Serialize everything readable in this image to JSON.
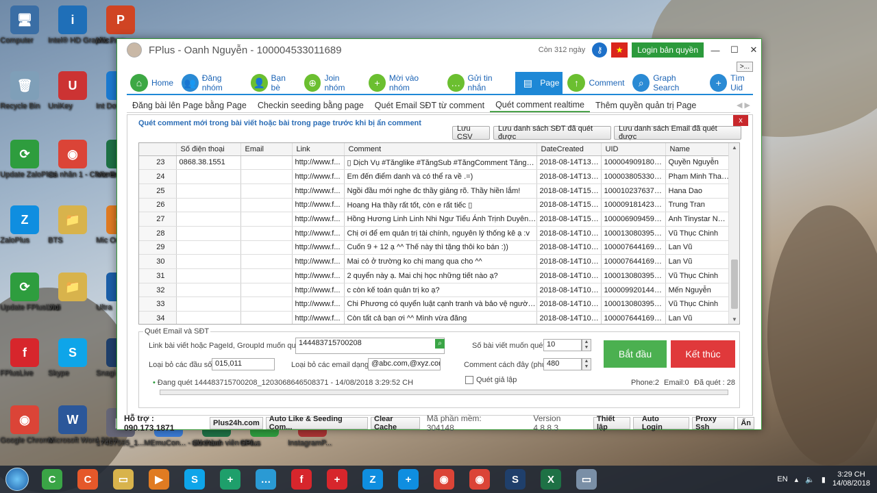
{
  "desktop": {
    "icons": [
      {
        "label": "Computer",
        "glyph": "🖥",
        "color": "#3a6ea5"
      },
      {
        "label": "Intel® HD Graphic...",
        "glyph": "i",
        "color": "#1f6fb8"
      },
      {
        "label": "Mic Pow",
        "glyph": "P",
        "color": "#d04423"
      },
      {
        "label": "Recycle Bin",
        "glyph": "🗑",
        "color": "#7f9fb8"
      },
      {
        "label": "UniKey",
        "glyph": "U",
        "color": "#c33"
      },
      {
        "label": "Int Dov",
        "glyph": "e",
        "color": "#1b7ad1"
      },
      {
        "label": "Update ZaloPlus",
        "glyph": "⟳",
        "color": "#2e9d3e"
      },
      {
        "label": "Cá nhân 1 - Chrome",
        "glyph": "◉",
        "color": "#db4437"
      },
      {
        "label": "Mic Exc",
        "glyph": "X",
        "color": "#1e7145"
      },
      {
        "label": "ZaloPlus",
        "glyph": "Z",
        "color": "#0f8ee0"
      },
      {
        "label": "BTS",
        "glyph": "📁",
        "color": "#d8b34c"
      },
      {
        "label": "Mic Outlo",
        "glyph": "O",
        "color": "#e07b22"
      },
      {
        "label": "Update FPlusLive",
        "glyph": "⟳",
        "color": "#2e9d3e"
      },
      {
        "label": "Vidi",
        "glyph": "📁",
        "color": "#d8b34c"
      },
      {
        "label": "Ultra",
        "glyph": "U",
        "color": "#1c5fa8"
      },
      {
        "label": "FPlusLive",
        "glyph": "f",
        "color": "#d7262c"
      },
      {
        "label": "Skype",
        "glyph": "S",
        "color": "#0ea5e9"
      },
      {
        "label": "Snagi - Sh",
        "glyph": "S",
        "color": "#1f3f6b"
      },
      {
        "label": "Google Chrome",
        "glyph": "◉",
        "color": "#db4437"
      },
      {
        "label": "Microsoft Word 2010",
        "glyph": "W",
        "color": "#2b579a"
      },
      {
        "label": "17457595_1...",
        "glyph": "▦",
        "color": "#667"
      },
      {
        "label": "MEmuCon... - Shortcut",
        "glyph": "M",
        "color": "#3a7bd5"
      },
      {
        "label": "uid thành viên nhó...",
        "glyph": "X",
        "color": "#1e7145"
      },
      {
        "label": "GPlus",
        "glyph": "G",
        "color": "#2e9d3e"
      },
      {
        "label": "InstagramP...",
        "glyph": "I",
        "color": "#a33"
      }
    ]
  },
  "window": {
    "title": "FPlus - Oanh Nguyễn - 100004533011689",
    "remaining": "Còn 312 ngày",
    "login_label": "Login bản quyền",
    "more_label": ">..."
  },
  "nav": [
    {
      "label": "Home",
      "icon": "home-icon",
      "glyph": "⌂",
      "color": "#3da844"
    },
    {
      "label": "Đăng nhóm",
      "icon": "group-post-icon",
      "glyph": "👥",
      "color": "#2a8ad4"
    },
    {
      "label": "Bạn bè",
      "icon": "friends-icon",
      "glyph": "👤",
      "color": "#6bbf30"
    },
    {
      "label": "Join nhóm",
      "icon": "join-group-icon",
      "glyph": "⊕",
      "color": "#6bbf30"
    },
    {
      "label": "Mời vào nhóm",
      "icon": "invite-icon",
      "glyph": "+",
      "color": "#6bbf30"
    },
    {
      "label": "Gửi tin nhắn",
      "icon": "message-icon",
      "glyph": "…",
      "color": "#6bbf30"
    },
    {
      "label": "Page",
      "icon": "page-icon",
      "glyph": "▤",
      "color": "#6bbf30"
    },
    {
      "label": "Comment",
      "icon": "comment-icon",
      "glyph": "↑",
      "color": "#6bbf30"
    },
    {
      "label": "Graph Search",
      "icon": "search-icon",
      "glyph": "⌕",
      "color": "#2a8ad4"
    },
    {
      "label": "Tìm Uid",
      "icon": "find-uid-icon",
      "glyph": "+",
      "color": "#2a8ad4"
    }
  ],
  "nav_active": "Page",
  "subtabs": [
    "Đăng bài lên Page bằng Page",
    "Checkin seeding bằng page",
    "Quét Email SĐT từ comment",
    "Quét comment realtime",
    "Thêm quyền quản trị Page"
  ],
  "panel": {
    "title": "Quét comment mới trong bài viết hoặc bài trong page trước khi bị ẩn comment",
    "buttons": [
      "Lưu CSV",
      "Lưu danh sách SĐT đã quét được",
      "Lưu danh sách Email đã quét được"
    ],
    "close_label": "x"
  },
  "grid": {
    "columns": [
      "",
      "Số điện thoại",
      "Email",
      "Link",
      "Comment",
      "DateCreated",
      "UID",
      "Name"
    ],
    "rows": [
      [
        "23",
        "0868.38.1551",
        "",
        "http://www.f...",
        "▯ Dịch Vụ #Tănglike #TăngSub #TăngComment  Tăng mắt ...",
        "2018-08-14T13:1...",
        "100004909180970",
        "Quyền Nguyễn"
      ],
      [
        "24",
        "",
        "",
        "http://www.f...",
        "Em đến điểm danh và có thể ra về .=)",
        "2018-08-14T13:1...",
        "100003805330344",
        "Phạm Minh Thanh"
      ],
      [
        "25",
        "",
        "",
        "http://www.f...",
        "Ngồi đầu mới nghe đc thầy giảng rõ. Thầy hiền lắm!",
        "2018-08-14T15:0...",
        "100010237637440",
        "Hana Dao"
      ],
      [
        "26",
        "",
        "",
        "http://www.f...",
        "Hoang Ha thầy rất tốt, còn e rất tiếc ▯",
        "2018-08-14T15:0...",
        "100009181423400",
        "Trung Tran"
      ],
      [
        "27",
        "",
        "",
        "http://www.f...",
        "Hồng Hương Linh Linh Nhi Ngư Tiểu Ánh Trịnh Duyên các ...",
        "2018-08-14T15:1...",
        "100006909459660",
        "Anh Tinystar Ngo..."
      ],
      [
        "28",
        "",
        "",
        "http://www.f...",
        "Chị ơi để em quản trị tài chính, nguyên lý thống kê ạ :v",
        "2018-08-14T10:2...",
        "100013080395075",
        "Vũ Thục Chinh"
      ],
      [
        "29",
        "",
        "",
        "http://www.f...",
        "Cuốn 9 + 12 ạ ^^ Thế này thì tặng thôi ko bán :))",
        "2018-08-14T10:2...",
        "100007644169144",
        "Lan Vũ"
      ],
      [
        "30",
        "",
        "",
        "http://www.f...",
        "Mai có ở trường ko chị mang qua cho ^^",
        "2018-08-14T10:2...",
        "100007644169144",
        "Lan Vũ"
      ],
      [
        "31",
        "",
        "",
        "http://www.f...",
        "2 quyển này ạ. Mai chị học những tiết nào ạ?",
        "2018-08-14T10:3...",
        "100013080395075",
        "Vũ Thục Chinh"
      ],
      [
        "32",
        "",
        "",
        "http://www.f...",
        "c còn kế toán quản trị ko ạ?",
        "2018-08-14T10:3...",
        "100009920144717",
        "Mến Nguyễn"
      ],
      [
        "33",
        "",
        "",
        "http://www.f...",
        "Chi Phương có quyển luật cạnh tranh và bảo vệ người tiêu ...",
        "2018-08-14T10:3...",
        "100013080395075",
        "Vũ Thục Chinh"
      ],
      [
        "34",
        "",
        "",
        "http://www.f...",
        "Còn tất cả bạn ơi ^^ Mình vừa đăng",
        "2018-08-14T10:3...",
        "100007644169144",
        "Lan Vũ"
      ]
    ]
  },
  "scan": {
    "group_title": "Quét Email và SĐT",
    "link_label": "Link bài viết hoặc PageId, GroupId muốn quét",
    "link_value": "144483715700208",
    "prefix_label": "Loại bỏ các đầu số",
    "prefix_value": "015,011",
    "email_label": "Loại bỏ các email dạng",
    "email_value": "@abc.com,@xyz.com",
    "posts_label": "Số bài viết muốn quét",
    "posts_value": "10",
    "interval_label": "Comment cách đây (phút)",
    "interval_value": "480",
    "fake_label": "Quét giả lập",
    "start_label": "Bắt đầu",
    "stop_label": "Kết thúc",
    "status": "Đang quét 144483715700208_1203068646508371 - 14/08/2018 3:29:52 CH",
    "phone_count": "Phone:2",
    "email_count": "Email:0",
    "scanned_count": "Đã quét : 28"
  },
  "statusbar": {
    "support": "Hỗ trợ : 090.173.1871",
    "btns_left": [
      "Plus24h.com",
      "Auto Like & Seeding Com...",
      "Clear Cache"
    ],
    "software_code": "Mã phần mềm: 304148",
    "version": "Version 4.8.8.3",
    "btns_right": [
      "Thiết lập",
      "Auto Login",
      "Proxy Ssh",
      "Ẩn"
    ]
  },
  "taskbar": {
    "items": [
      {
        "name": "ccleaner",
        "glyph": "C",
        "color": "#3aa546"
      },
      {
        "name": "ccleaner-2",
        "glyph": "C",
        "color": "#e5582a"
      },
      {
        "name": "explorer",
        "glyph": "▭",
        "color": "#d8b34c"
      },
      {
        "name": "media",
        "glyph": "▶",
        "color": "#e07b22"
      },
      {
        "name": "skype",
        "glyph": "S",
        "color": "#0ea5e9"
      },
      {
        "name": "plus-green",
        "glyph": "+",
        "color": "#1e9f6b"
      },
      {
        "name": "chat",
        "glyph": "…",
        "color": "#2a9ad4"
      },
      {
        "name": "fplus",
        "glyph": "f",
        "color": "#d7262c"
      },
      {
        "name": "plus-red",
        "glyph": "+",
        "color": "#d7262c"
      },
      {
        "name": "zalo",
        "glyph": "Z",
        "color": "#0f8ee0"
      },
      {
        "name": "plus-blue",
        "glyph": "+",
        "color": "#0f8ee0"
      },
      {
        "name": "chrome",
        "glyph": "◉",
        "color": "#db4437"
      },
      {
        "name": "chrome-2",
        "glyph": "◉",
        "color": "#db4437"
      },
      {
        "name": "snagit",
        "glyph": "S",
        "color": "#1f3f6b"
      },
      {
        "name": "excel",
        "glyph": "X",
        "color": "#1e7145"
      },
      {
        "name": "other",
        "glyph": "▭",
        "color": "#7a8fa6"
      }
    ],
    "lang": "EN",
    "time": "3:29 CH",
    "date": "14/08/2018"
  }
}
